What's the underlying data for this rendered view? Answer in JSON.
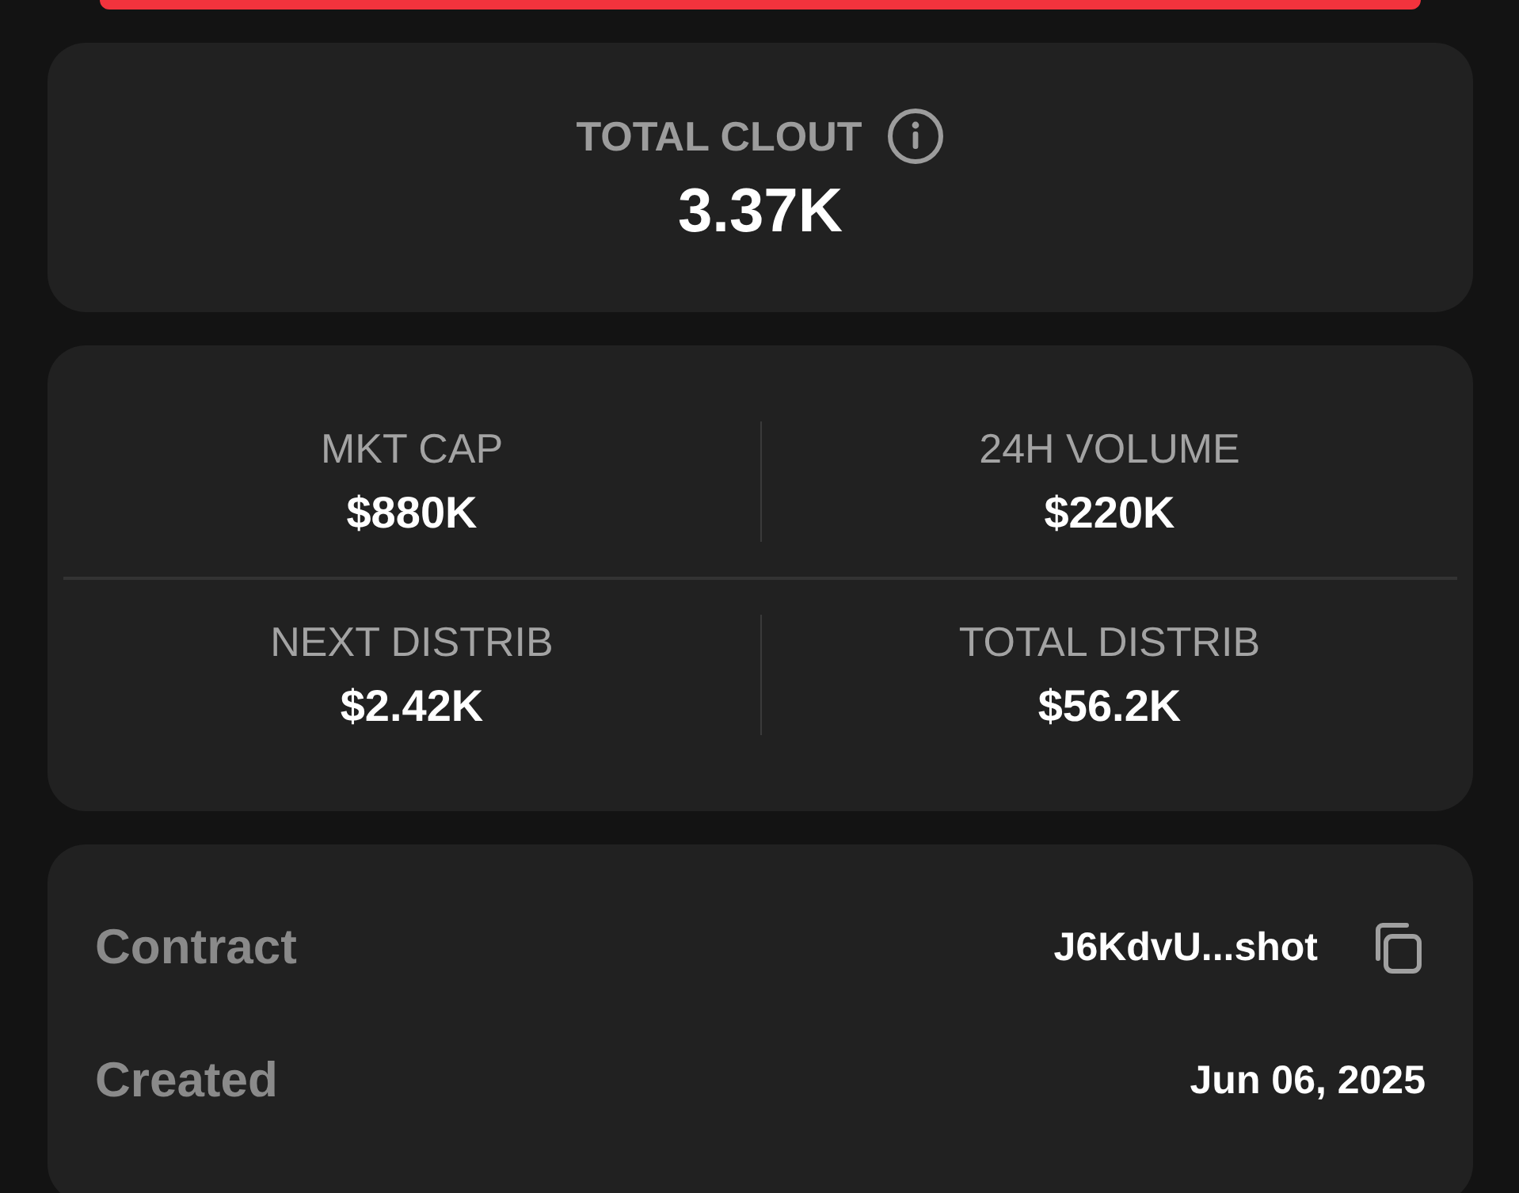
{
  "clout": {
    "label": "TOTAL CLOUT",
    "value": "3.37K"
  },
  "stats": [
    {
      "label": "MKT CAP",
      "value": "$880K"
    },
    {
      "label": "24H VOLUME",
      "value": "$220K"
    },
    {
      "label": "NEXT DISTRIB",
      "value": "$2.42K"
    },
    {
      "label": "TOTAL DISTRIB",
      "value": "$56.2K"
    }
  ],
  "details": [
    {
      "label": "Contract",
      "value": "J6KdvU...shot",
      "kind": "copy"
    },
    {
      "label": "Created",
      "value": "Jun 06, 2025",
      "kind": "plain"
    }
  ]
}
